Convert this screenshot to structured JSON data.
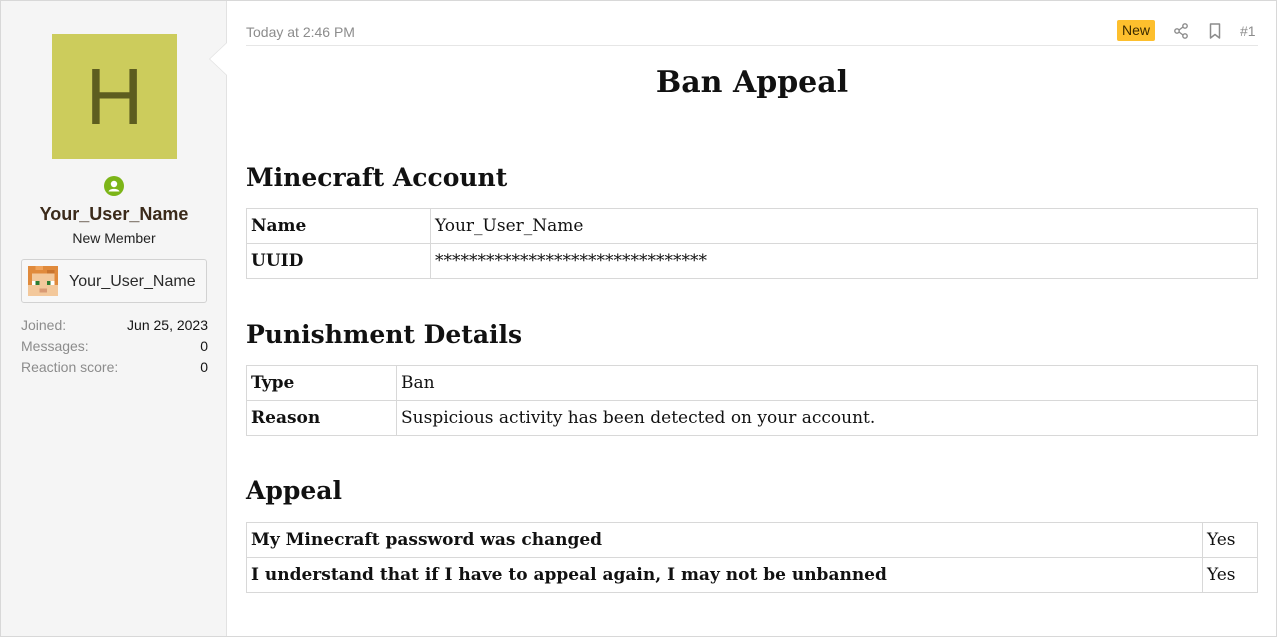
{
  "sidebar": {
    "avatar_letter": "H",
    "username": "Your_User_Name",
    "user_title": "New Member",
    "minecraft_name": "Your_User_Name",
    "stats": [
      {
        "label": "Joined:",
        "value": "Jun 25, 2023"
      },
      {
        "label": "Messages:",
        "value": "0"
      },
      {
        "label": "Reaction score:",
        "value": "0"
      }
    ],
    "colors": {
      "avatar_bg": "#cccc5c",
      "online": "#7cb518"
    }
  },
  "header": {
    "timestamp": "Today at 2:46 PM",
    "badge": "New",
    "post_number": "#1",
    "icons": [
      "share-icon",
      "bookmark-icon"
    ]
  },
  "post": {
    "title": "Ban Appeal",
    "sections": [
      {
        "heading": "Minecraft Account",
        "rows": [
          {
            "key": "Name",
            "value": "Your_User_Name"
          },
          {
            "key": "UUID",
            "value": "********************************"
          }
        ]
      },
      {
        "heading": "Punishment Details",
        "rows": [
          {
            "key": "Type",
            "value": "Ban"
          },
          {
            "key": "Reason",
            "value": "Suspicious activity has been detected on your account."
          }
        ]
      },
      {
        "heading": "Appeal",
        "rows": [
          {
            "key": "My Minecraft password was changed",
            "value": "Yes"
          },
          {
            "key": "I understand that if I have to appeal again, I may not be unbanned",
            "value": "Yes"
          }
        ]
      }
    ]
  }
}
